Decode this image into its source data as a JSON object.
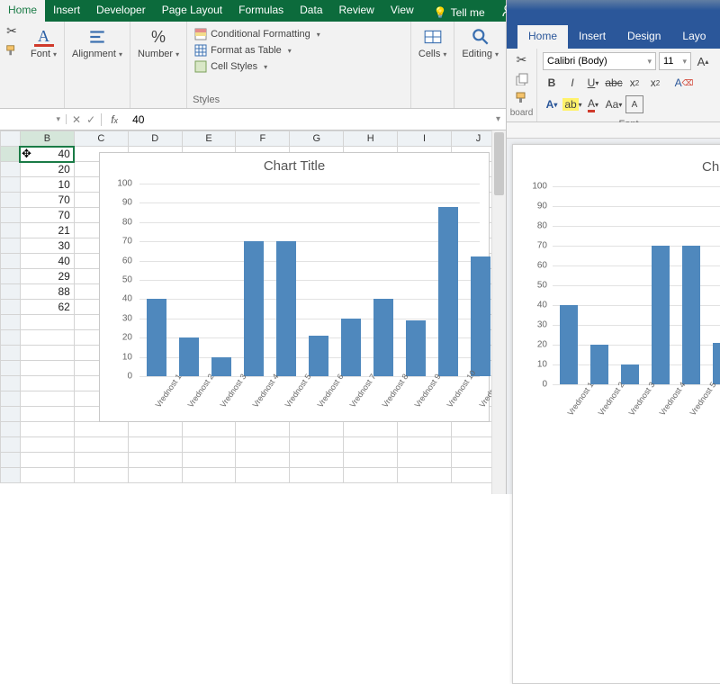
{
  "excel": {
    "tabs": [
      "Home",
      "Insert",
      "Developer",
      "Page Layout",
      "Formulas",
      "Data",
      "Review",
      "View"
    ],
    "tellme": "Tell me",
    "ribbon": {
      "font": "Font",
      "alignment": "Alignment",
      "number": "Number",
      "styles_group": "Styles",
      "cond_fmt": "Conditional Formatting",
      "fmt_table": "Format as Table",
      "cell_styles": "Cell Styles",
      "cells": "Cells",
      "editing": "Editing"
    },
    "namebox": "",
    "formula": "40",
    "columns": [
      "B",
      "C",
      "D",
      "E",
      "F",
      "G",
      "H",
      "I",
      "J"
    ],
    "rowdata": [
      40,
      20,
      10,
      70,
      70,
      21,
      30,
      40,
      29,
      88,
      62
    ],
    "selected_cell": "B1"
  },
  "word": {
    "tabs": [
      "Home",
      "Insert",
      "Design",
      "Layo"
    ],
    "font_name": "Calibri (Body)",
    "font_size": "11",
    "group_font": "Font",
    "clipboard": "board"
  },
  "chart_data": {
    "type": "bar",
    "title": "Chart Title",
    "ylim": [
      0,
      100
    ],
    "yticks": [
      0,
      10,
      20,
      30,
      40,
      50,
      60,
      70,
      80,
      90,
      100
    ],
    "categories": [
      "Vrednost 1",
      "Vrednost 2",
      "Vrednost 3",
      "Vrednost 4",
      "Vrednost 5",
      "Vrednost 6",
      "Vrednost 7",
      "Vrednost 8",
      "Vrednost 9",
      "Vrednost 10",
      "Vrednost"
    ],
    "values": [
      40,
      20,
      10,
      70,
      70,
      21,
      30,
      40,
      29,
      88,
      62
    ],
    "word_title": "Ch"
  }
}
